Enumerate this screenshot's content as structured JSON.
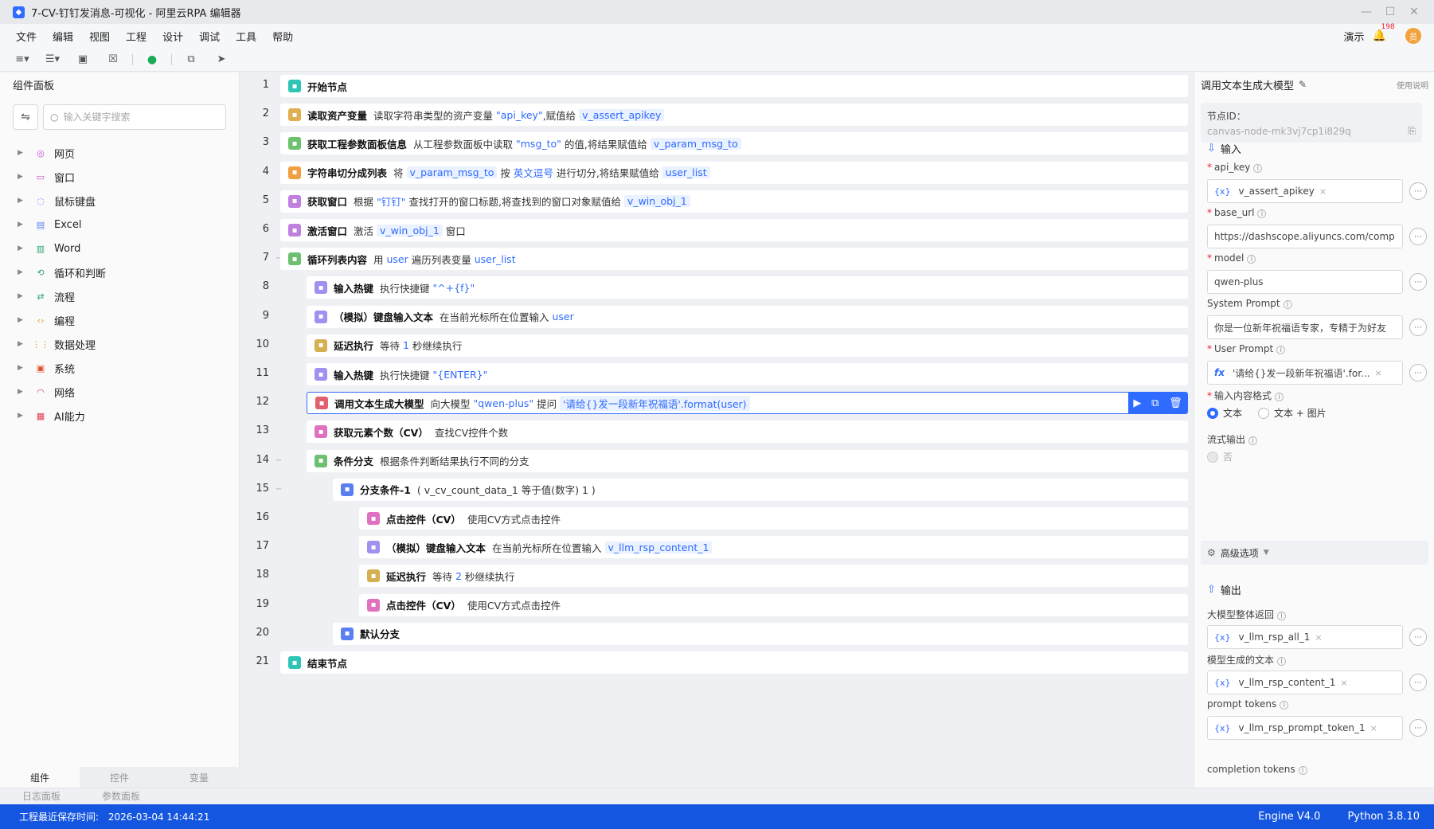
{
  "window": {
    "title": "7-CV-钉钉发消息-可视化 - 阿里云RPA 编辑器",
    "controls": [
      "—",
      "☐",
      "✕"
    ]
  },
  "menu": {
    "items": [
      "文件",
      "编辑",
      "视图",
      "工程",
      "设计",
      "调试",
      "工具",
      "帮助"
    ],
    "demo": "演示",
    "notif_count": "198",
    "avatar": "员"
  },
  "left_panel": {
    "title": "组件面板",
    "search_placeholder": "输入关键字搜索",
    "tree": [
      {
        "label": "网页",
        "icon": "globe-icon",
        "color": "#c94fd0"
      },
      {
        "label": "窗口",
        "icon": "window-icon",
        "color": "#c94fd0"
      },
      {
        "label": "鼠标键盘",
        "icon": "mouse-icon",
        "color": "#7b6cf0"
      },
      {
        "label": "Excel",
        "icon": "excel-icon",
        "color": "#5b7ff0"
      },
      {
        "label": "Word",
        "icon": "word-icon",
        "color": "#2aa56c"
      },
      {
        "label": "循环和判断",
        "icon": "loop-icon",
        "color": "#2aa56c"
      },
      {
        "label": "流程",
        "icon": "flow-icon",
        "color": "#2aa56c"
      },
      {
        "label": "编程",
        "icon": "code-icon",
        "color": "#e0a020"
      },
      {
        "label": "数据处理",
        "icon": "data-icon",
        "color": "#e0a020"
      },
      {
        "label": "系统",
        "icon": "system-icon",
        "color": "#e05030"
      },
      {
        "label": "网络",
        "icon": "wifi-icon",
        "color": "#e04050"
      },
      {
        "label": "AI能力",
        "icon": "ai-icon",
        "color": "#e04050"
      }
    ],
    "tabs": [
      "组件",
      "控件",
      "变量"
    ]
  },
  "bottom_tabs": [
    "日志面板",
    "参数面板"
  ],
  "status": {
    "save_label": "工程最近保存时间:",
    "save_time": "2026-03-04 14:44:21",
    "engine": "Engine V4.0",
    "python": "Python 3.8.10"
  },
  "flow": [
    {
      "n": "1",
      "indent": 0,
      "color": "#2ec4b6",
      "parts": [
        {
          "t": "name",
          "v": "开始节点"
        }
      ]
    },
    {
      "n": "2",
      "indent": 0,
      "color": "#e0b050",
      "parts": [
        {
          "t": "name",
          "v": "读取资产变量"
        },
        {
          "t": "desc",
          "v": "读取字符串类型的资产变量 "
        },
        {
          "t": "var",
          "v": "\"api_key\""
        },
        {
          "t": "desc",
          "v": ",赋值给 "
        },
        {
          "t": "box",
          "v": "v_assert_apikey"
        }
      ]
    },
    {
      "n": "3",
      "indent": 0,
      "color": "#6cc070",
      "parts": [
        {
          "t": "name",
          "v": "获取工程参数面板信息"
        },
        {
          "t": "desc",
          "v": "从工程参数面板中读取 "
        },
        {
          "t": "var",
          "v": "\"msg_to\""
        },
        {
          "t": "desc",
          "v": " 的值,将结果赋值给 "
        },
        {
          "t": "box",
          "v": "v_param_msg_to"
        }
      ]
    },
    {
      "n": "4",
      "indent": 0,
      "color": "#f0a040",
      "parts": [
        {
          "t": "name",
          "v": "字符串切分成列表"
        },
        {
          "t": "desc",
          "v": "将 "
        },
        {
          "t": "box",
          "v": "v_param_msg_to"
        },
        {
          "t": "desc",
          "v": " 按 "
        },
        {
          "t": "var",
          "v": "英文逗号"
        },
        {
          "t": "desc",
          "v": " 进行切分,将结果赋值给 "
        },
        {
          "t": "box",
          "v": "user_list"
        }
      ]
    },
    {
      "n": "5",
      "indent": 0,
      "color": "#c080e0",
      "parts": [
        {
          "t": "name",
          "v": "获取窗口"
        },
        {
          "t": "desc",
          "v": "根据 "
        },
        {
          "t": "var",
          "v": "\"钉钉\""
        },
        {
          "t": "desc",
          "v": " 查找打开的窗口标题,将查找到的窗口对象赋值给 "
        },
        {
          "t": "box",
          "v": "v_win_obj_1"
        }
      ]
    },
    {
      "n": "6",
      "indent": 0,
      "color": "#c080e0",
      "parts": [
        {
          "t": "name",
          "v": "激活窗口"
        },
        {
          "t": "desc",
          "v": "激活 "
        },
        {
          "t": "box",
          "v": "v_win_obj_1"
        },
        {
          "t": "desc",
          "v": " 窗口"
        }
      ]
    },
    {
      "n": "7",
      "indent": 0,
      "fold": true,
      "color": "#6cc070",
      "parts": [
        {
          "t": "name",
          "v": "循环列表内容"
        },
        {
          "t": "desc",
          "v": "用 "
        },
        {
          "t": "var",
          "v": "user"
        },
        {
          "t": "desc",
          "v": " 遍历列表变量 "
        },
        {
          "t": "var",
          "v": "user_list"
        }
      ]
    },
    {
      "n": "8",
      "indent": 1,
      "color": "#a090f0",
      "parts": [
        {
          "t": "name",
          "v": "输入热键"
        },
        {
          "t": "desc",
          "v": "执行快捷键 "
        },
        {
          "t": "var",
          "v": "\"^+{f}\""
        }
      ]
    },
    {
      "n": "9",
      "indent": 1,
      "color": "#a090f0",
      "parts": [
        {
          "t": "name",
          "v": "（模拟）键盘输入文本"
        },
        {
          "t": "desc",
          "v": "在当前光标所在位置输入 "
        },
        {
          "t": "var",
          "v": "user"
        }
      ]
    },
    {
      "n": "10",
      "indent": 1,
      "color": "#d4b050",
      "parts": [
        {
          "t": "name",
          "v": "延迟执行"
        },
        {
          "t": "desc",
          "v": "等待 "
        },
        {
          "t": "var",
          "v": "1"
        },
        {
          "t": "desc",
          "v": " 秒继续执行"
        }
      ]
    },
    {
      "n": "11",
      "indent": 1,
      "color": "#a090f0",
      "parts": [
        {
          "t": "name",
          "v": "输入热键"
        },
        {
          "t": "desc",
          "v": "执行快捷键 "
        },
        {
          "t": "var",
          "v": "\"{ENTER}\""
        }
      ]
    },
    {
      "n": "12",
      "indent": 1,
      "selected": true,
      "color": "#e06070",
      "parts": [
        {
          "t": "name",
          "v": "调用文本生成大模型"
        },
        {
          "t": "desc",
          "v": "向大模型 "
        },
        {
          "t": "var",
          "v": "\"qwen-plus\""
        },
        {
          "t": "desc",
          "v": " 提问 "
        },
        {
          "t": "box",
          "v": "'请给{}发一段新年祝福语'.format(user)"
        }
      ]
    },
    {
      "n": "13",
      "indent": 1,
      "color": "#e070c0",
      "parts": [
        {
          "t": "name",
          "v": "获取元素个数（CV）"
        },
        {
          "t": "desc",
          "v": "查找CV控件个数"
        }
      ]
    },
    {
      "n": "14",
      "indent": 1,
      "fold": true,
      "color": "#6cc070",
      "parts": [
        {
          "t": "name",
          "v": "条件分支"
        },
        {
          "t": "desc",
          "v": "根据条件判断结果执行不同的分支"
        }
      ]
    },
    {
      "n": "15",
      "indent": 2,
      "fold": true,
      "color": "#5b7ff0",
      "parts": [
        {
          "t": "name",
          "v": "分支条件-1"
        },
        {
          "t": "desc",
          "v": "( v_cv_count_data_1 等于值(数字) 1 )"
        }
      ]
    },
    {
      "n": "16",
      "indent": 3,
      "color": "#e070c0",
      "parts": [
        {
          "t": "name",
          "v": "点击控件（CV）"
        },
        {
          "t": "desc",
          "v": "使用CV方式点击控件"
        }
      ]
    },
    {
      "n": "17",
      "indent": 3,
      "color": "#a090f0",
      "parts": [
        {
          "t": "name",
          "v": "（模拟）键盘输入文本"
        },
        {
          "t": "desc",
          "v": "在当前光标所在位置输入 "
        },
        {
          "t": "box",
          "v": "v_llm_rsp_content_1"
        }
      ]
    },
    {
      "n": "18",
      "indent": 3,
      "color": "#d4b050",
      "parts": [
        {
          "t": "name",
          "v": "延迟执行"
        },
        {
          "t": "desc",
          "v": "等待 "
        },
        {
          "t": "var",
          "v": "2"
        },
        {
          "t": "desc",
          "v": " 秒继续执行"
        }
      ]
    },
    {
      "n": "19",
      "indent": 3,
      "color": "#e070c0",
      "parts": [
        {
          "t": "name",
          "v": "点击控件（CV）"
        },
        {
          "t": "desc",
          "v": "使用CV方式点击控件"
        }
      ]
    },
    {
      "n": "20",
      "indent": 2,
      "color": "#5b7ff0",
      "parts": [
        {
          "t": "name",
          "v": "默认分支"
        }
      ]
    },
    {
      "n": "21",
      "indent": 0,
      "color": "#2ec4b6",
      "parts": [
        {
          "t": "name",
          "v": "结束节点"
        }
      ]
    }
  ],
  "right_panel": {
    "title": "调用文本生成大模型",
    "help": "使用说明",
    "node_id_label": "节点ID：",
    "node_id": "canvas-node-mk3vj7cp1i829q",
    "input_section": "输入",
    "output_section": "输出",
    "fields": {
      "api_key": {
        "label": "api_key",
        "value": "v_assert_apikey"
      },
      "base_url": {
        "label": "base_url",
        "value": "https://dashscope.aliyuncs.com/comp"
      },
      "model": {
        "label": "model",
        "value": "qwen-plus"
      },
      "system_prompt": {
        "label": "System Prompt",
        "value": "你是一位新年祝福语专家，专精于为好友"
      },
      "user_prompt": {
        "label": "User Prompt",
        "value": "'请给{}发一段新年祝福语'.for..."
      },
      "input_format": {
        "label": "输入内容格式",
        "opt1": "文本",
        "opt2": "文本 + 图片"
      },
      "stream": {
        "label": "流式输出",
        "opt": "否"
      },
      "advanced": "高级选项",
      "out_all": {
        "label": "大模型整体返回",
        "value": "v_llm_rsp_all_1"
      },
      "out_text": {
        "label": "模型生成的文本",
        "value": "v_llm_rsp_content_1"
      },
      "out_prompt_tokens": {
        "label": "prompt tokens",
        "value": "v_llm_rsp_prompt_token_1"
      },
      "out_completion": {
        "label": "completion tokens"
      }
    }
  }
}
